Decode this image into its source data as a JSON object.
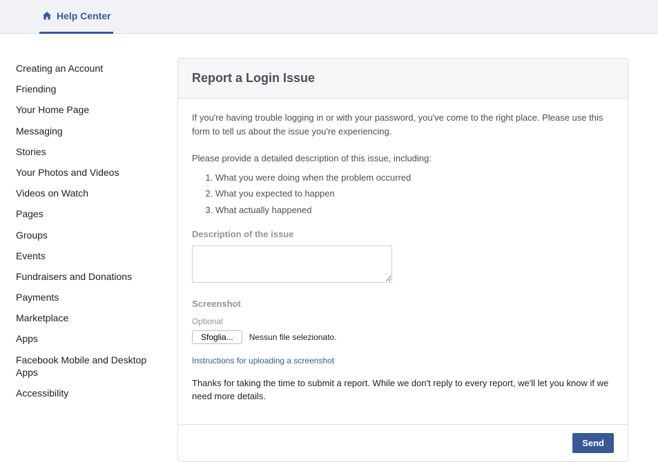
{
  "topbar": {
    "tab_label": "Help Center"
  },
  "sidebar": {
    "items": [
      "Creating an Account",
      "Friending",
      "Your Home Page",
      "Messaging",
      "Stories",
      "Your Photos and Videos",
      "Videos on Watch",
      "Pages",
      "Groups",
      "Events",
      "Fundraisers and Donations",
      "Payments",
      "Marketplace",
      "Apps",
      "Facebook Mobile and Desktop Apps",
      "Accessibility"
    ]
  },
  "card": {
    "title": "Report a Login Issue",
    "intro": "If you're having trouble logging in or with your password, you've come to the right place. Please use this form to tell us about the issue you're experiencing.",
    "prompt": "Please provide a detailed description of this issue, including:",
    "steps": [
      "What you were doing when the problem occurred",
      "What you expected to happen",
      "What actually happened"
    ],
    "description_label": "Description of the issue",
    "screenshot_label": "Screenshot",
    "optional": "Optional",
    "browse_button": "Sfoglia...",
    "no_file": "Nessun file selezionato.",
    "upload_link": "Instructions for uploading a screenshot",
    "thanks": "Thanks for taking the time to submit a report. While we don't reply to every report, we'll let you know if we need more details.",
    "send": "Send"
  }
}
